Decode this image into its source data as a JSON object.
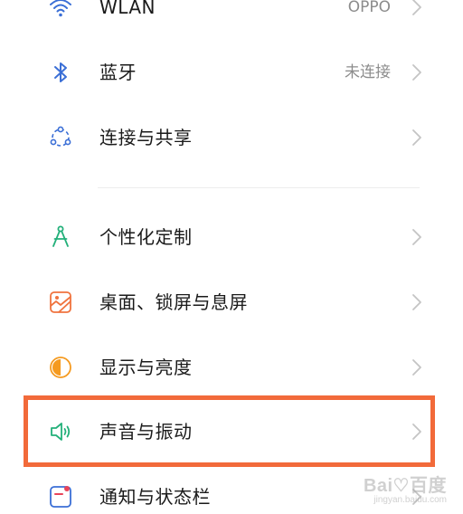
{
  "settings": {
    "items": [
      {
        "label": "WLAN",
        "value": "OPPO"
      },
      {
        "label": "蓝牙",
        "value": "未连接"
      },
      {
        "label": "连接与共享",
        "value": ""
      },
      {
        "label": "个性化定制",
        "value": ""
      },
      {
        "label": "桌面、锁屏与息屏",
        "value": ""
      },
      {
        "label": "显示与亮度",
        "value": ""
      },
      {
        "label": "声音与振动",
        "value": ""
      },
      {
        "label": "通知与状态栏",
        "value": ""
      }
    ]
  },
  "colors": {
    "wlan_icon": "#3b6fd6",
    "bluetooth_icon": "#3b6fd6",
    "connect_icon": "#3b6fd6",
    "personalize_icon": "#23b07a",
    "desktop_icon": "#f0733e",
    "display_icon": "#f59a1f",
    "sound_icon": "#23b07a",
    "notification_icon": "#e8445a",
    "highlight": "#f26a3a"
  },
  "watermark": {
    "main": "Bai♡百度",
    "sub": "jingyan.baidu.com"
  }
}
